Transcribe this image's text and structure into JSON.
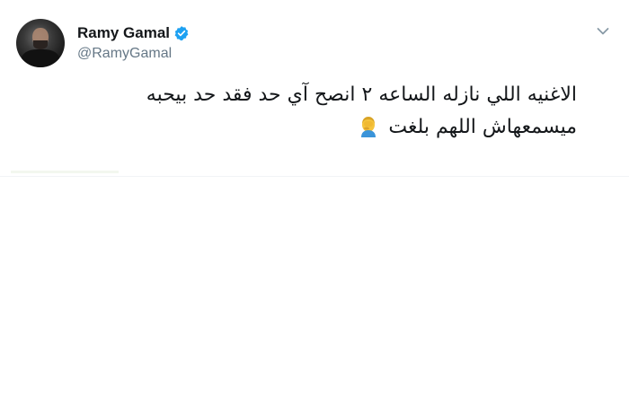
{
  "tweet": {
    "display_name": "Ramy Gamal",
    "handle": "@RamyGamal",
    "verified": true,
    "text_line_1": "الاغنيه اللي نازله الساعه ٢ انصح آي حد فقد حد بيحبه",
    "text_line_2": "ميسمعهاش اللهم بلغت",
    "emoji": "face-palm-emoji-icon"
  },
  "colors": {
    "verified_blue": "#1da1f2",
    "text": "#14171a",
    "secondary": "#657786"
  },
  "icons": {
    "menu": "chevron-down-icon",
    "verified": "verified-badge-icon"
  }
}
